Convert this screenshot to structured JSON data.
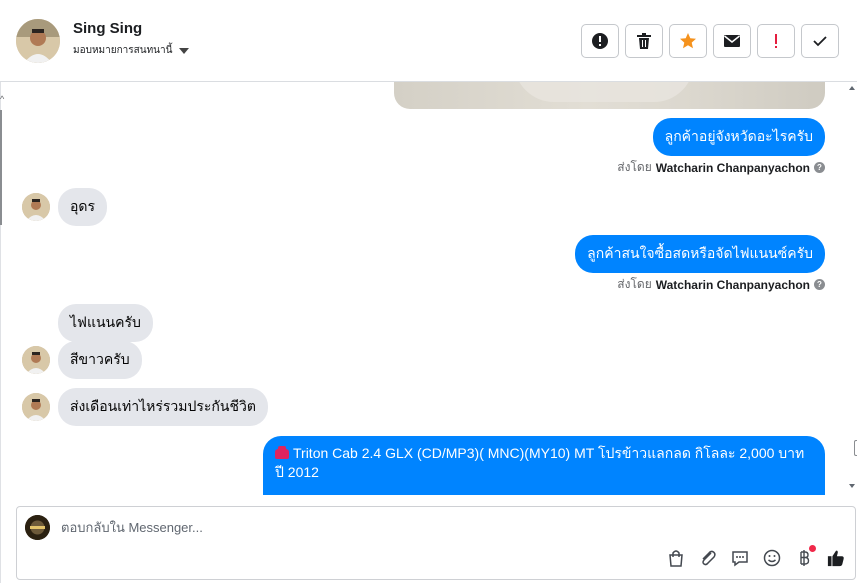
{
  "header": {
    "contact_name": "Sing Sing",
    "assign_label": "มอบหมายการสนทนานี้",
    "toolbar": [
      {
        "name": "mark-spam-button",
        "icon": "alert-circle-icon"
      },
      {
        "name": "delete-button",
        "icon": "trash-icon"
      },
      {
        "name": "star-button",
        "icon": "star-icon"
      },
      {
        "name": "mark-unread-button",
        "icon": "envelope-icon"
      },
      {
        "name": "follow-up-button",
        "icon": "exclamation-icon"
      },
      {
        "name": "mark-done-button",
        "icon": "checkmark-icon"
      }
    ]
  },
  "messages": [
    {
      "id": "m1",
      "direction": "out",
      "text": "ลูกค้าอยู่จังหวัดอะไรครับ"
    },
    {
      "id": "s1",
      "type": "sent_by",
      "prefix": "ส่งโดย",
      "author": "Watcharin Chanpanyachon"
    },
    {
      "id": "m2",
      "direction": "in",
      "text": "อุดร"
    },
    {
      "id": "m3",
      "direction": "out",
      "text": "ลูกค้าสนใจซื้อสดหรือจัดไฟแนนซ์ครับ"
    },
    {
      "id": "s2",
      "type": "sent_by",
      "prefix": "ส่งโดย",
      "author": "Watcharin Chanpanyachon"
    },
    {
      "id": "m4",
      "direction": "in",
      "text": "ไฟแนนครับ"
    },
    {
      "id": "m5",
      "direction": "in",
      "text": "สีขาวครับ"
    },
    {
      "id": "m6",
      "direction": "in",
      "text": "ส่งเดือนเท่าไหร่รวมประกันชีวิต"
    },
    {
      "id": "m7",
      "direction": "out",
      "icon": "car-icon",
      "text": "Triton Cab 2.4 GLX (CD/MP3)( MNC)(MY10) MT โปรข้าวแลกลด กิโลละ 2,000 บาท ปี 2012"
    }
  ],
  "composer": {
    "placeholder": "ตอบกลับใน Messenger...",
    "icons": [
      "shopping-bag-icon",
      "paperclip-icon",
      "saved-reply-icon",
      "emoji-icon",
      "baht-icon",
      "thumbs-up-icon"
    ]
  },
  "colors": {
    "outgoing_bubble": "#0084ff",
    "incoming_bubble": "#e4e6eb",
    "star": "#f5921d",
    "exclamation": "#e41e3f",
    "notification_dot": "#f02849"
  }
}
